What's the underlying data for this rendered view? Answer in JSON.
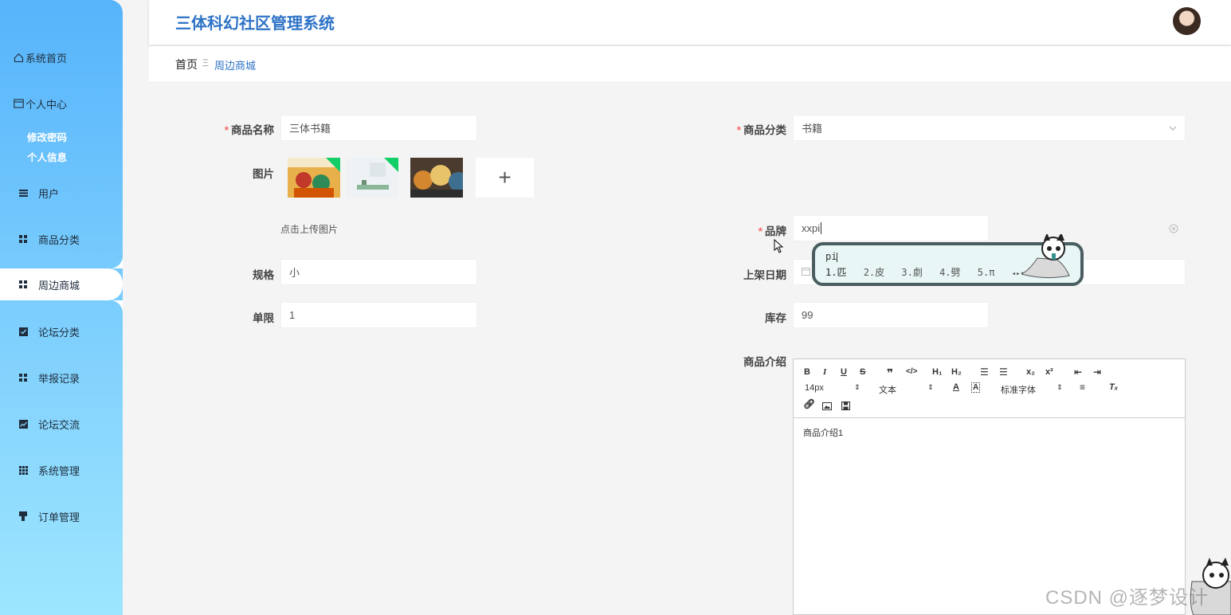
{
  "app": {
    "title": "三体科幻社区管理系统"
  },
  "sidebar": {
    "items": [
      {
        "label": "系统首页",
        "icon": "home-icon"
      },
      {
        "label": "个人中心",
        "icon": "card-icon"
      },
      {
        "label": "修改密码"
      },
      {
        "label": "个人信息"
      },
      {
        "label": "用户",
        "icon": "menu-icon"
      },
      {
        "label": "商品分类",
        "icon": "grid-icon"
      },
      {
        "label": "周边商城",
        "icon": "grid-icon",
        "active": true
      },
      {
        "label": "论坛分类",
        "icon": "clipboard-check-icon"
      },
      {
        "label": "举报记录",
        "icon": "grid-icon"
      },
      {
        "label": "论坛交流",
        "icon": "chart-icon"
      },
      {
        "label": "系统管理",
        "icon": "grid9-icon"
      },
      {
        "label": "订单管理",
        "icon": "stamp-icon"
      }
    ]
  },
  "breadcrumb": {
    "home": "首页",
    "separator": "Ξ",
    "current": "周边商城"
  },
  "form": {
    "name": {
      "label": "商品名称",
      "value": "三体书籍"
    },
    "category": {
      "label": "商品分类",
      "value": "书籍"
    },
    "images": {
      "label": "图片",
      "hint": "点击上传图片",
      "add": "+"
    },
    "brand": {
      "label": "品牌",
      "value": "xxpi"
    },
    "spec": {
      "label": "规格",
      "value": "小"
    },
    "shelf_date": {
      "label": "上架日期"
    },
    "limit": {
      "label": "单限",
      "value": "1"
    },
    "stock": {
      "label": "库存",
      "value": "99"
    },
    "intro": {
      "label": "商品介绍",
      "content": "商品介绍1"
    }
  },
  "editor": {
    "font_size": "14px",
    "block_type": "文本",
    "font_family": "标准字体"
  },
  "ime": {
    "input": "pi",
    "candidates": [
      "1.匹",
      "2.皮",
      "3.劇",
      "4.劈",
      "5.π"
    ]
  },
  "watermark": "CSDN @逐梦设计"
}
